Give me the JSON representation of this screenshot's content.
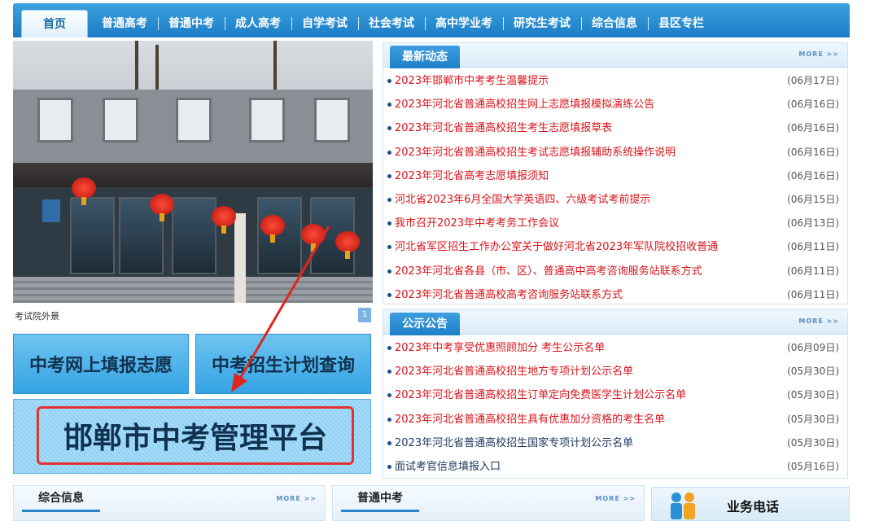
{
  "nav": {
    "items": [
      "首页",
      "普通高考",
      "普通中考",
      "成人高考",
      "自学考试",
      "社会考试",
      "高中学业考",
      "研究生考试",
      "综合信息",
      "县区专栏"
    ]
  },
  "photo": {
    "caption": "考试院外景",
    "page": "1"
  },
  "buttons": {
    "left": "中考网上填报志愿",
    "right": "中考招生计划查询",
    "big": "邯郸市中考管理平台"
  },
  "news": {
    "title": "最新动态",
    "more": "MORE >>",
    "items": [
      {
        "text": "2023年邯郸市中考考生温馨提示",
        "date": "(06月17日)"
      },
      {
        "text": "2023年河北省普通高校招生网上志愿填报模拟演练公告",
        "date": "(06月16日)"
      },
      {
        "text": "2023年河北省普通高校招生考生志愿填报草表",
        "date": "(06月16日)"
      },
      {
        "text": "2023年河北省普通高校招生考试志愿填报辅助系统操作说明",
        "date": "(06月16日)"
      },
      {
        "text": "2023年河北省高考志愿填报须知",
        "date": "(06月16日)"
      },
      {
        "text": "河北省2023年6月全国大学英语四、六级考试考前提示",
        "date": "(06月15日)"
      },
      {
        "text": "我市召开2023年中考考务工作会议",
        "date": "(06月13日)"
      },
      {
        "text": "河北省军区招生工作办公室关于做好河北省2023年军队院校招收普通",
        "date": "(06月11日)"
      },
      {
        "text": "2023年河北省各县（市、区）、普通高中高考咨询服务站联系方式",
        "date": "(06月11日)"
      },
      {
        "text": "2023年河北省普通高校高考咨询服务站联系方式",
        "date": "(06月11日)"
      }
    ]
  },
  "notice": {
    "title": "公示公告",
    "more": "MORE >>",
    "items": [
      {
        "text": "2023年中考享受优惠照顾加分 考生公示名单",
        "date": "(06月09日)",
        "red": true
      },
      {
        "text": "2023年河北省普通高校招生地方专项计划公示名单",
        "date": "(05月30日)",
        "red": true
      },
      {
        "text": "2023年河北省普通高校招生订单定向免费医学生计划公示名单",
        "date": "(05月30日)",
        "red": true
      },
      {
        "text": "2023年河北省普通高校招生具有优惠加分资格的考生名单",
        "date": "(05月30日)",
        "red": true
      },
      {
        "text": "2023年河北省普通高校招生国家专项计划公示名单",
        "date": "(05月30日)",
        "red": false
      },
      {
        "text": "面试考官信息填报入口",
        "date": "(05月16日)",
        "red": false
      }
    ]
  },
  "bottom": {
    "general_info": "综合信息",
    "general_more": "MORE >>",
    "zhongkao": "普通中考",
    "zhongkao_more": "MORE >>",
    "phone": "业务电话"
  }
}
